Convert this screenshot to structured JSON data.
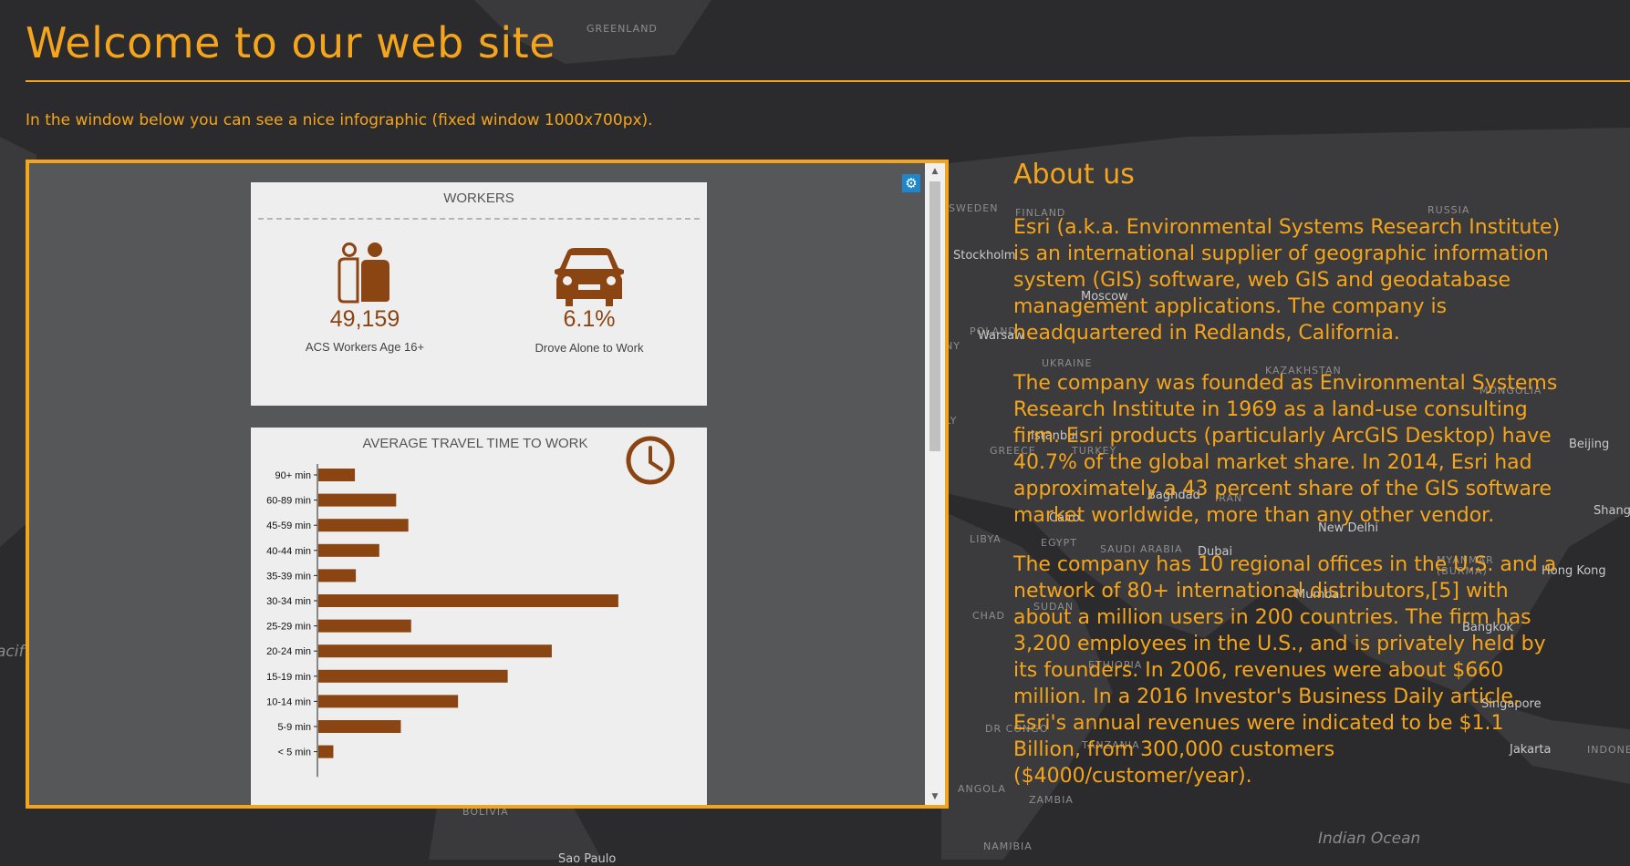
{
  "header": {
    "title": "Welcome to our web site",
    "intro": "In the window below you can see a nice infographic (fixed window 1000x700px)."
  },
  "map": {
    "region_labels": [
      "GREENLAND",
      "SWEDEN",
      "FINLAND",
      "RUSSIA",
      "POLAND",
      "UKRAINE",
      "KAZAKHSTAN",
      "MONGOLIA",
      "GREECE",
      "TURKEY",
      "IRAN",
      "LIBYA",
      "EGYPT",
      "SAUDI ARABIA",
      "SUDAN",
      "CHAD",
      "ETHIOPIA",
      "DR CONGO",
      "TANZANIA",
      "ANGOLA",
      "ZAMBIA",
      "NAMIBIA",
      "BOLIVIA",
      "MYANMAR (BURMA)",
      "INDONE",
      "NY",
      "LY"
    ],
    "city_labels": [
      "Stockholm",
      "Moscow",
      "Warsaw",
      "Istanbul",
      "Baghdad",
      "Cairo",
      "Dubai",
      "New Delhi",
      "Mumbai",
      "Bangkok",
      "Singapore",
      "Jakarta",
      "Hong Kong",
      "Beijing",
      "Shang",
      "Sao Paulo"
    ],
    "ocean_labels": [
      "Indian Ocean",
      "acif"
    ]
  },
  "infographic": {
    "workers": {
      "title": "WORKERS",
      "stat1_value": "49,159",
      "stat1_label": "ACS Workers Age 16+",
      "stat2_value": "6.1%",
      "stat2_label": "Drove Alone to Work"
    },
    "travel": {
      "title": "AVERAGE TRAVEL TIME TO WORK"
    },
    "settings_icon": "gear-icon",
    "bar_color": "#8b4513"
  },
  "chart_data": {
    "type": "bar",
    "orientation": "horizontal",
    "title": "AVERAGE TRAVEL TIME TO WORK",
    "categories": [
      "90+ min",
      "60-89 min",
      "45-59 min",
      "40-44 min",
      "35-39 min",
      "30-34 min",
      "25-29 min",
      "20-24 min",
      "15-19 min",
      "10-14 min",
      "5-9 min",
      "< 5 min"
    ],
    "values": [
      390,
      830,
      960,
      650,
      400,
      3200,
      990,
      2490,
      2020,
      1490,
      880,
      160
    ],
    "xlabel": "",
    "ylabel": "",
    "xlim": [
      0,
      3600
    ],
    "grid": false
  },
  "about": {
    "title": "About us",
    "p1": "Esri (a.k.a. Environmental Systems Research Institute) is an international supplier of geographic information system (GIS) software, web GIS and geodatabase management applications. The company is headquartered in Redlands, California.",
    "p2": "The company was founded as Environmental Systems Research Institute in 1969 as a land-use consulting firm. Esri products (particularly ArcGIS Desktop) have 40.7% of the global market share. In 2014, Esri had approximately a 43 percent share of the GIS software market worldwide, more than any other vendor.",
    "p3": "The company has 10 regional offices in the U.S. and a network of 80+ international distributors,[5] with about a million users in 200 countries. The firm has 3,200 employees in the U.S., and is privately held by its founders. In 2006, revenues were about $660 million. In a 2016 Investor's Business Daily article, Esri's annual revenues were indicated to be $1.1 Billion, from 300,000 customers ($4000/customer/year)."
  },
  "colors": {
    "accent": "#f5a51c",
    "map_background": "#2b2b2d",
    "frame_background": "#555759",
    "card_background": "#efeeee",
    "settings_button": "#1f86c9"
  }
}
